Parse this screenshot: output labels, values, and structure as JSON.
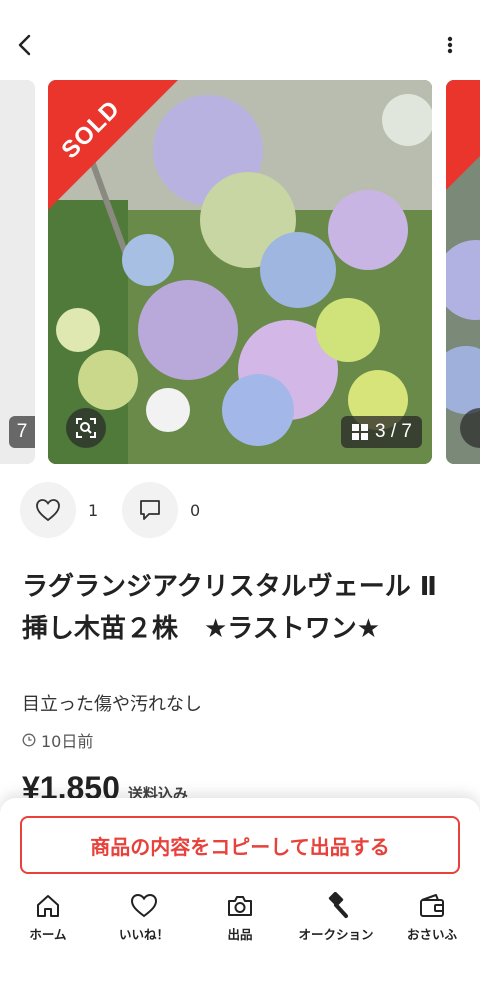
{
  "carousel": {
    "sold_label": "SOLD",
    "counter": "3 / 7",
    "prev_counter": "7"
  },
  "actions": {
    "like_count": "1",
    "comment_count": "0"
  },
  "item": {
    "title": "ラグランジアクリスタルヴェール Ⅱ 挿し木苗２株　★ラストワン★",
    "condition": "目立った傷や汚れなし",
    "posted": "10日前",
    "price": "¥1,850",
    "shipping": "送料込み"
  },
  "copy_button": {
    "label": "商品の内容をコピーして出品する"
  },
  "tabs": [
    {
      "label": "ホーム",
      "icon": "home-icon"
    },
    {
      "label": "いいね！",
      "icon": "heart-icon"
    },
    {
      "label": "出品",
      "icon": "camera-icon"
    },
    {
      "label": "オークション",
      "icon": "gavel-icon"
    },
    {
      "label": "おさいふ",
      "icon": "wallet-icon"
    }
  ],
  "colors": {
    "accent": "#e8403a",
    "sold": "#ea352d"
  }
}
